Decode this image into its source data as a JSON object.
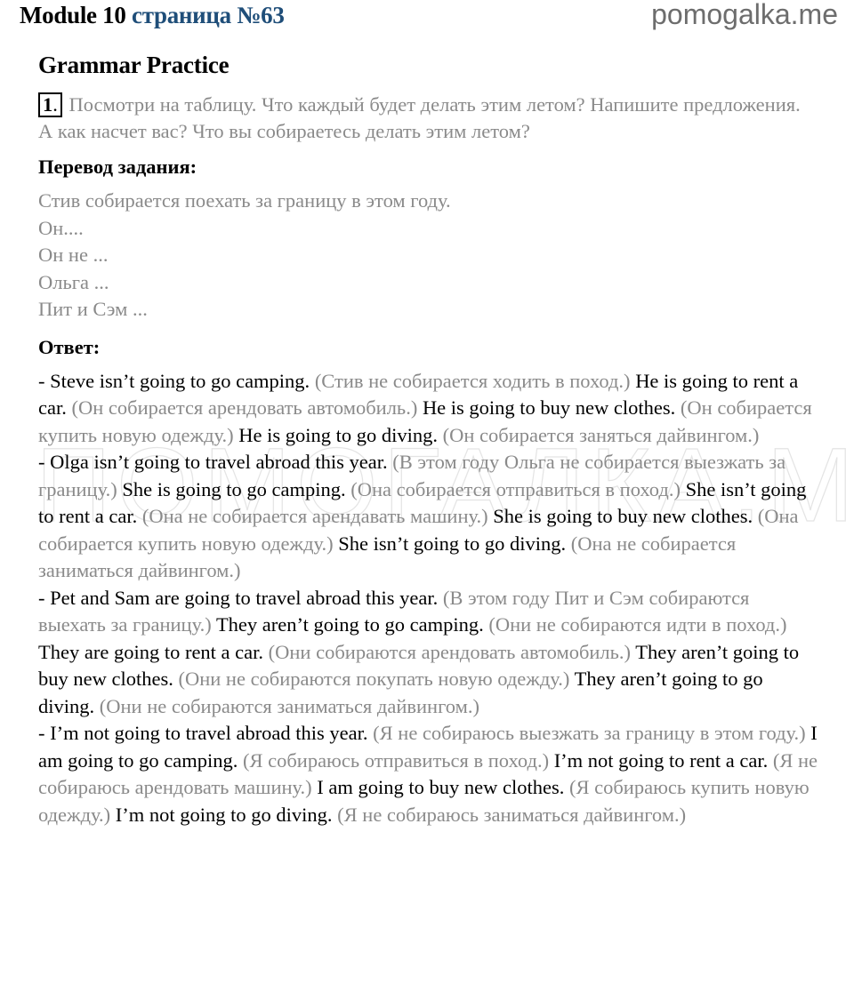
{
  "header": {
    "module": "Module 10",
    "page": "страница №63",
    "site": "pomogalka.me"
  },
  "watermark": "ПОМОГАЛКА.МИ",
  "section_title": "Grammar Practice",
  "task": {
    "number": "1",
    "text_line1": "Посмотри на таблицу. Что каждый будет делать этим летом? Напишите предложения.",
    "text_line2": "А как насчет вас? Что вы собираетесь делать этим летом?"
  },
  "translation": {
    "heading": "Перевод задания:",
    "lines": [
      "Стив собирается поехать за границу в этом году.",
      "Он....",
      "Он не ...",
      "Ольга ...",
      "Пит и Сэм ..."
    ]
  },
  "answer": {
    "heading": "Ответ:",
    "paragraphs": [
      {
        "segments": [
          {
            "en": "- Steve isn’t going to go camping.",
            "ru": "(Стив не собирается ходить в поход.)"
          },
          {
            "en": "He is going to rent a car.",
            "ru": "(Он собирается арендовать автомобиль.)"
          },
          {
            "en": "He is going to buy new clothes.",
            "ru": "(Он собирается купить новую одежду.)"
          },
          {
            "en": "He is going to go diving.",
            "ru": "(Он собирается заняться дайвингом.)"
          }
        ]
      },
      {
        "segments": [
          {
            "en": "- Olga isn’t going to travel abroad this year.",
            "ru": "(В этом году Ольга не собирается выезжать за границу.)"
          },
          {
            "en": "She is going to go camping.",
            "ru": "(Она собирается отправиться в поход.)"
          },
          {
            "en": "She isn’t going to rent a car.",
            "ru": "(Она не собирается арендавать машину.)"
          },
          {
            "en": "She is going to buy new clothes.",
            "ru": "(Она собирается купить новую одежду.)"
          },
          {
            "en": "She isn’t going to go diving.",
            "ru": "(Она не собирается заниматься дайвингом.)"
          }
        ]
      },
      {
        "segments": [
          {
            "en": "- Pet and Sam are going to travel abroad this year.",
            "ru": "(В этом году Пит и Сэм собираются выехать за границу.)"
          },
          {
            "en": "They aren’t going to go camping.",
            "ru": "(Они не собираются идти в поход.)"
          },
          {
            "en": "They are going to rent a car.",
            "ru": "(Они собираются арендовать автомобиль.)"
          },
          {
            "en": "They aren’t going to buy new clothes.",
            "ru": "(Они не собираются покупать новую одежду.)"
          },
          {
            "en": "They aren’t going to go diving.",
            "ru": "(Они не собираются заниматься дайвингом.)"
          }
        ]
      },
      {
        "segments": [
          {
            "en": "- I’m not going to travel abroad this year.",
            "ru": "(Я не собираюсь выезжать за границу в этом году.)"
          },
          {
            "en": "I am going to go camping.",
            "ru": "(Я собираюсь отправиться в поход.)"
          },
          {
            "en": "I’m not going to rent a car.",
            "ru": "(Я не собираюсь арендовать машину.)"
          },
          {
            "en": "I am going to buy new clothes.",
            "ru": "(Я собираюсь купить новую одежду.)"
          },
          {
            "en": "I’m not going to go diving.",
            "ru": "(Я не собираюсь заниматься дайвингом.)"
          }
        ]
      }
    ]
  },
  "colors": {
    "page_link": "#1f4e79",
    "muted_text": "#8a8a8a",
    "site_text": "#6d6d6d"
  }
}
